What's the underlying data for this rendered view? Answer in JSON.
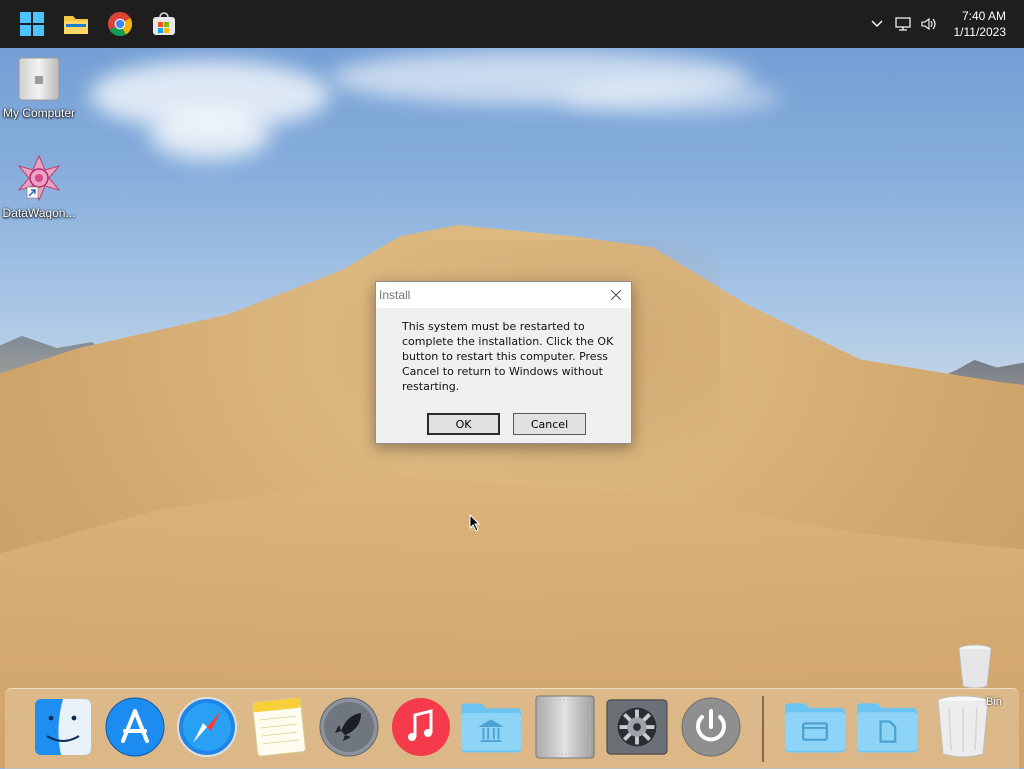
{
  "taskbar": {
    "pinned": [
      {
        "name": "start-button",
        "icon": "windows-logo-icon"
      },
      {
        "name": "file-explorer",
        "icon": "folder-icon"
      },
      {
        "name": "chrome",
        "icon": "chrome-icon"
      },
      {
        "name": "microsoft-store",
        "icon": "store-icon"
      }
    ],
    "tray": {
      "chevron": "chevron-up-icon",
      "network": "network-icon",
      "volume": "volume-icon"
    },
    "time": "7:40 AM",
    "date": "1/11/2023"
  },
  "desktop_icons": [
    {
      "label": "My Computer",
      "icon": "computer-icon"
    },
    {
      "label": "DataWagon...",
      "icon": "datawagon-shortcut-icon"
    }
  ],
  "dialog": {
    "title": "Install",
    "message": "This system must be restarted to complete the installation. Click the OK button to restart this computer. Press Cancel to return to Windows without restarting.",
    "ok_label": "OK",
    "cancel_label": "Cancel"
  },
  "dock": {
    "items": [
      {
        "name": "finder",
        "icon": "finder-icon"
      },
      {
        "name": "app-store",
        "icon": "app-store-icon"
      },
      {
        "name": "safari",
        "icon": "safari-icon"
      },
      {
        "name": "notes",
        "icon": "notes-icon"
      },
      {
        "name": "launchpad",
        "icon": "rocket-icon"
      },
      {
        "name": "music",
        "icon": "music-icon"
      },
      {
        "name": "applications-folder",
        "icon": "applications-folder-icon"
      },
      {
        "name": "mac-pro",
        "icon": "computer-icon"
      },
      {
        "name": "system-preferences",
        "icon": "gear-icon"
      },
      {
        "name": "shutdown",
        "icon": "power-icon"
      },
      {
        "name": "desktop-folder",
        "icon": "folder-icon"
      },
      {
        "name": "documents-folder",
        "icon": "folder-icon"
      },
      {
        "name": "trash",
        "icon": "trash-icon"
      }
    ],
    "bin_label": "Bin"
  }
}
